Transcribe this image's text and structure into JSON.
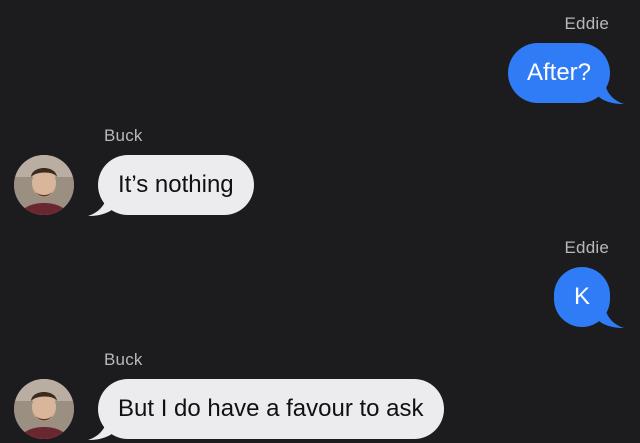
{
  "messages": [
    {
      "sender": "Eddie",
      "text": "After?",
      "direction": "outgoing"
    },
    {
      "sender": "Buck",
      "text": "It’s nothing",
      "direction": "incoming"
    },
    {
      "sender": "Eddie",
      "text": "K",
      "direction": "outgoing"
    },
    {
      "sender": "Buck",
      "text": "But I do have a favour to ask",
      "direction": "incoming"
    }
  ],
  "colors": {
    "background": "#1c1c1e",
    "outgoing_bubble": "#2f7cf6",
    "incoming_bubble": "#ececef",
    "sender_label": "#b8b8bc"
  },
  "icons": {
    "avatar": "profile-photo"
  }
}
